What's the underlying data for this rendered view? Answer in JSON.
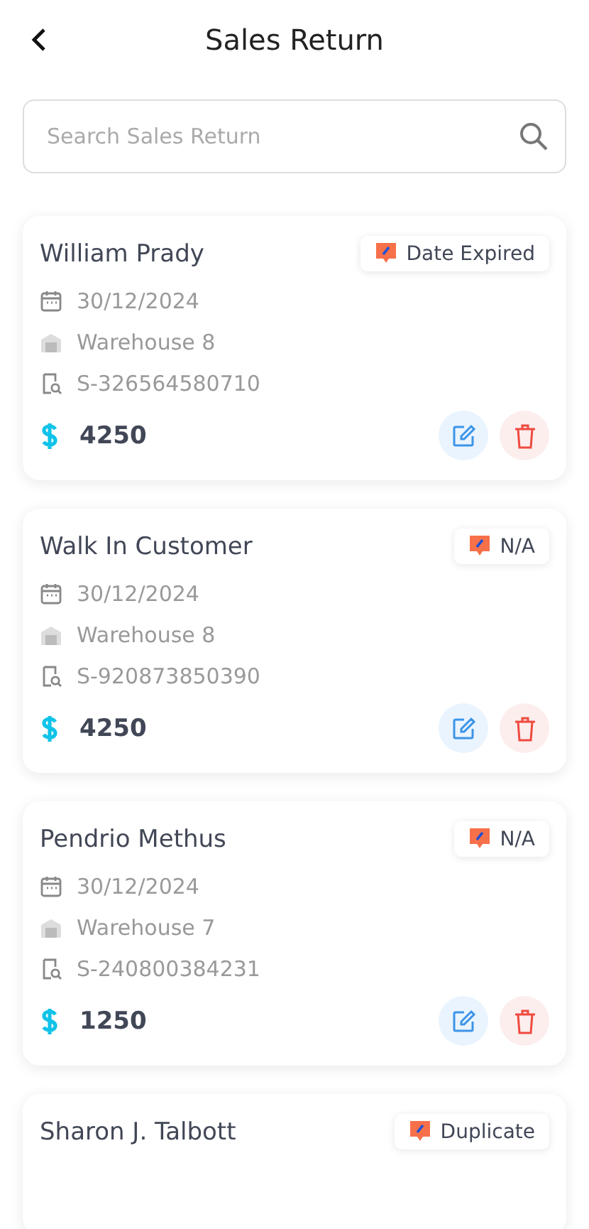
{
  "header": {
    "title": "Sales Return"
  },
  "search": {
    "placeholder": "Search Sales Return"
  },
  "returns": [
    {
      "customer": "William Prady",
      "status": "Date Expired",
      "date": "30/12/2024",
      "warehouse": "Warehouse 8",
      "reference": "S-326564580710",
      "amount": "4250"
    },
    {
      "customer": "Walk In Customer",
      "status": "N/A",
      "date": "30/12/2024",
      "warehouse": "Warehouse 8",
      "reference": "S-920873850390",
      "amount": "4250"
    },
    {
      "customer": "Pendrio Methus",
      "status": "N/A",
      "date": "30/12/2024",
      "warehouse": "Warehouse 7",
      "reference": "S-240800384231",
      "amount": "1250"
    },
    {
      "customer": "Sharon J. Talbott",
      "status": "Duplicate"
    }
  ]
}
